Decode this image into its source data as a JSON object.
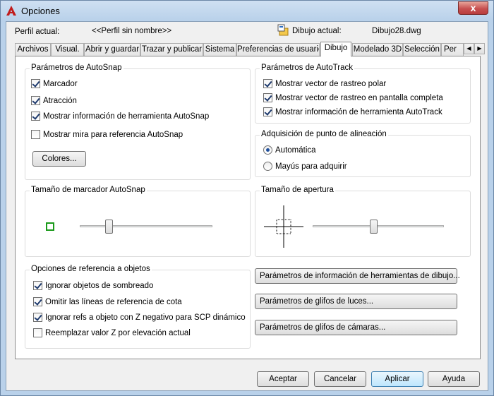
{
  "window": {
    "title": "Opciones",
    "close_glyph": "x"
  },
  "header": {
    "profile_label": "Perfil actual:",
    "profile_value": "<<Perfil sin nombre>>",
    "drawing_label": "Dibujo actual:",
    "drawing_value": "Dibujo28.dwg"
  },
  "tabs": [
    {
      "label": "Archivos"
    },
    {
      "label": "Visual."
    },
    {
      "label": "Abrir y guardar"
    },
    {
      "label": "Trazar y publicar"
    },
    {
      "label": "Sistema"
    },
    {
      "label": "Preferencias de usuario"
    },
    {
      "label": "Dibujo"
    },
    {
      "label": "Modelado 3D"
    },
    {
      "label": "Selección"
    },
    {
      "label": "Per"
    }
  ],
  "autosnap": {
    "title": "Parámetros de AutoSnap",
    "marker": {
      "label": "Marcador",
      "checked": true
    },
    "magnet": {
      "label": "Atracción",
      "checked": true
    },
    "tooltip": {
      "label": "Mostrar información de herramienta AutoSnap",
      "checked": true
    },
    "aperture": {
      "label": "Mostrar mira para referencia AutoSnap",
      "checked": false
    },
    "colors_button": "Colores..."
  },
  "autotrack": {
    "title": "Parámetros de AutoTrack",
    "polar": {
      "label": "Mostrar vector de rastreo polar",
      "checked": true
    },
    "fullscreen": {
      "label": "Mostrar vector de rastreo en pantalla completa",
      "checked": true
    },
    "tooltip": {
      "label": "Mostrar información de herramienta AutoTrack",
      "checked": true
    }
  },
  "alignment": {
    "title": "Adquisición de punto de alineación",
    "auto": {
      "label": "Automática",
      "selected": true
    },
    "shift": {
      "label": "Mayús para adquirir",
      "selected": false
    }
  },
  "marker_size": {
    "title": "Tamaño de marcador AutoSnap",
    "level": 0.22,
    "marker_color": "#1a9a1a"
  },
  "aperture_size": {
    "title": "Tamaño de apertura",
    "level": 0.46
  },
  "osnap": {
    "title": "Opciones de referencia a objetos",
    "ignore_hatch": {
      "label": "Ignorar objetos de sombreado",
      "checked": true
    },
    "dim_lines": {
      "label": "Omitir las líneas de referencia de cota",
      "checked": true
    },
    "neg_z": {
      "label": "Ignorar refs a objeto con Z negativo para SCP dinámico",
      "checked": true
    },
    "replace_z": {
      "label": "Reemplazar valor Z por elevación actual",
      "checked": false
    }
  },
  "side_buttons": {
    "drafting_tooltip": "Parámetros de información de herramientas de dibujo...",
    "light_glyph": "Parámetros de glifos de luces...",
    "camera_glyph": "Parámetros de glifos de cámaras..."
  },
  "footer": {
    "accept": "Aceptar",
    "cancel": "Cancelar",
    "apply": "Aplicar",
    "help": "Ayuda"
  },
  "colors": {
    "accent": "#3c7fb1",
    "title_bg": "#b9d1ea",
    "close_red": "#c75050"
  }
}
